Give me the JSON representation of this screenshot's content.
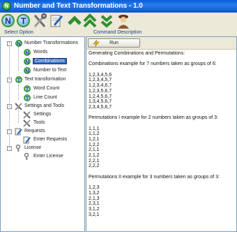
{
  "window": {
    "title": "Number and Text Transformations - 1.0",
    "icon_letter": "N"
  },
  "toolbar": {
    "buttons": [
      {
        "name": "numbers-button",
        "icon": "n-circle-icon",
        "letter": "N"
      },
      {
        "name": "text-button",
        "icon": "t-circle-icon",
        "letter": "T"
      },
      {
        "name": "tools-button",
        "icon": "tools-icon"
      },
      {
        "name": "edit-button",
        "icon": "edit-icon"
      },
      {
        "name": "up-button",
        "icon": "up-icon"
      },
      {
        "name": "top-button",
        "icon": "top-icon"
      },
      {
        "name": "down-button",
        "icon": "down-icon"
      },
      {
        "name": "user-button",
        "icon": "person-icon"
      }
    ]
  },
  "panels": {
    "left_label": "Select Option",
    "right_label": "Command Description"
  },
  "tree": {
    "numbers": {
      "label": "Number Transformations",
      "expander": "-",
      "children": [
        {
          "label": "Words",
          "selected": false
        },
        {
          "label": "Combinations",
          "selected": true
        },
        {
          "label": "Number to Text",
          "selected": false
        }
      ]
    },
    "text": {
      "label": "Text transformation",
      "expander": "-",
      "children": [
        {
          "label": "Word Count"
        },
        {
          "label": "Line Count"
        }
      ]
    },
    "settings": {
      "label": "Settings and Tools",
      "expander": "-",
      "children": [
        {
          "label": "Settings"
        },
        {
          "label": "Tools"
        }
      ]
    },
    "requests": {
      "label": "Requests",
      "expander": "-",
      "children": [
        {
          "label": "Enter Requests"
        }
      ]
    },
    "license": {
      "label": "License",
      "expander": "-",
      "children": [
        {
          "label": "Enter License"
        }
      ]
    }
  },
  "run": {
    "label": "Run"
  },
  "output": {
    "lines": [
      "Generating Combinations and Permutations:",
      "",
      "Combinations example for 7 numbers taken as groups of 6:",
      "",
      "1,2,3,4,5,6",
      "1,2,3,4,5,7",
      "1,2,3,4,6,7",
      "1,2,3,5,6,7",
      "1,2,4,5,6,7",
      "1,3,4,5,6,7",
      "2,3,4,5,6,7",
      "",
      "Permutations I example for 2 numbers taken as groups of 3:",
      "",
      "1,1,1",
      "1,1,2",
      "1,2,1",
      "1,2,2",
      "2,1,1",
      "2,1,2",
      "2,2,1",
      "2,2,2",
      "",
      "Permutations II example for 3 numbers taken as groups of 3:",
      "",
      "1,2,3",
      "1,3,2",
      "2,1,3",
      "2,3,1",
      "3,1,2",
      "3,2,1"
    ]
  }
}
